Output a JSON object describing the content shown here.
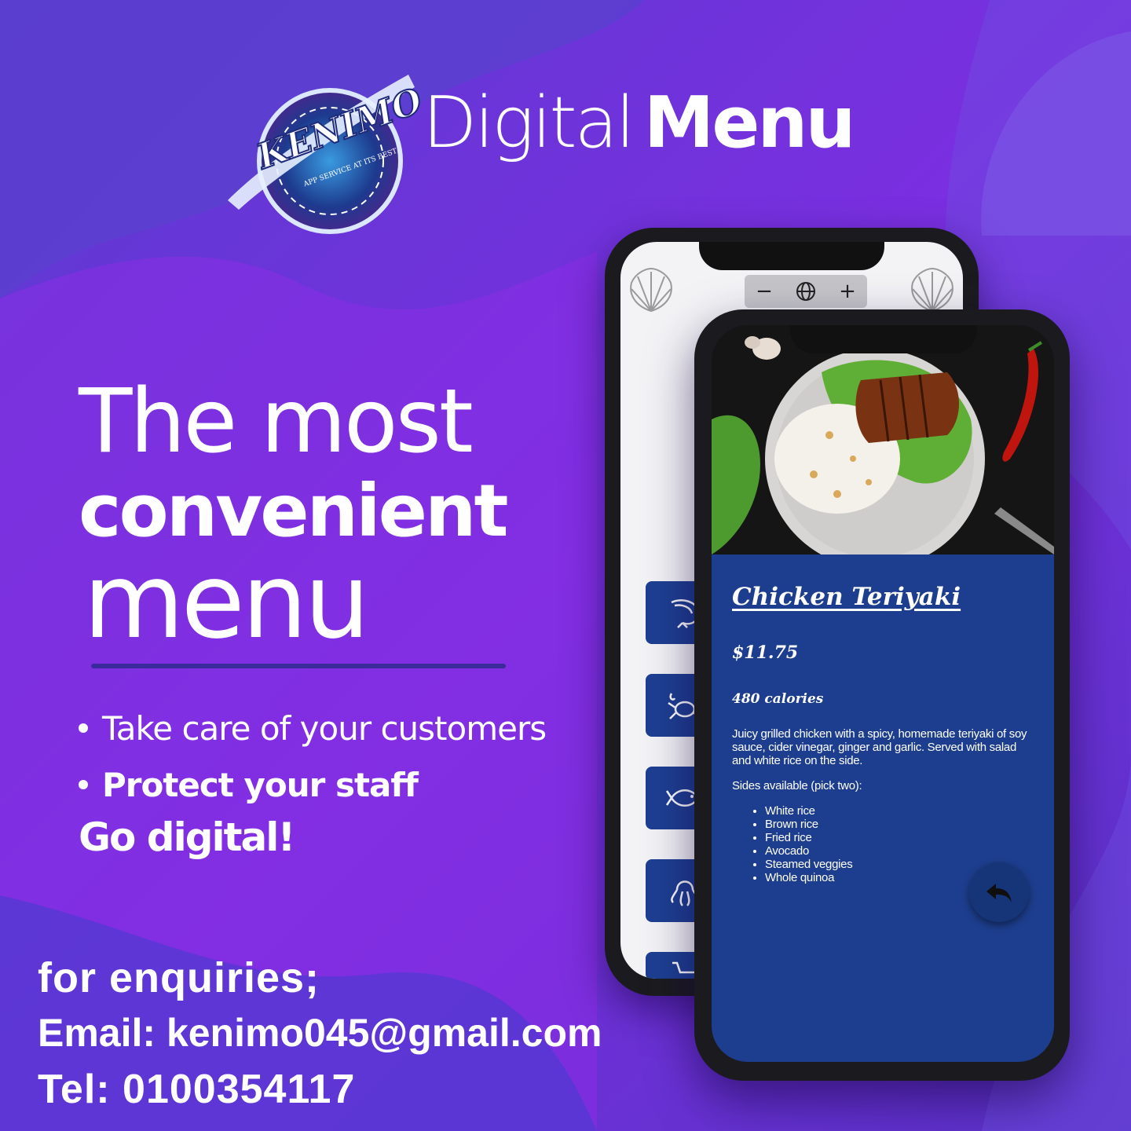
{
  "brand": {
    "logo_text": "KENIMO",
    "logo_tagline": "APP SERVICE AT ITS BEST",
    "title_light": "Digital",
    "title_bold": "Menu"
  },
  "headline": {
    "line1": "The most",
    "line2": "convenient",
    "line3": "menu"
  },
  "bullets": [
    "Take care of your customers",
    "Protect your staff"
  ],
  "cta": "Go digital!",
  "contact": {
    "heading": "for enquiries;",
    "email": "Email: kenimo045@gmail.com",
    "tel": "Tel: 0100354117"
  },
  "back_phone": {
    "zoom_out": "−",
    "zoom_in": "+",
    "categories": [
      "shrimp-icon",
      "crab-icon",
      "fish-icon",
      "octopus-icon",
      "cart-icon"
    ]
  },
  "dish": {
    "name": "Chicken Teriyaki",
    "price": "$11.75",
    "calories": "480 calories",
    "description": "Juicy grilled chicken with a spicy, homemade teriyaki of soy sauce, cider vinegar, ginger and garlic. Served with salad and white rice on the side.",
    "sides_label": "Sides available (pick two):",
    "sides": [
      "White rice",
      "Brown rice",
      "Fried rice",
      "Avocado",
      "Steamed veggies",
      "Whole quinoa"
    ]
  },
  "colors": {
    "background": "#6a2fd6",
    "screen_blue": "#1d3e8e",
    "category_button": "#1e3f92",
    "rule": "#3a2a9c"
  }
}
